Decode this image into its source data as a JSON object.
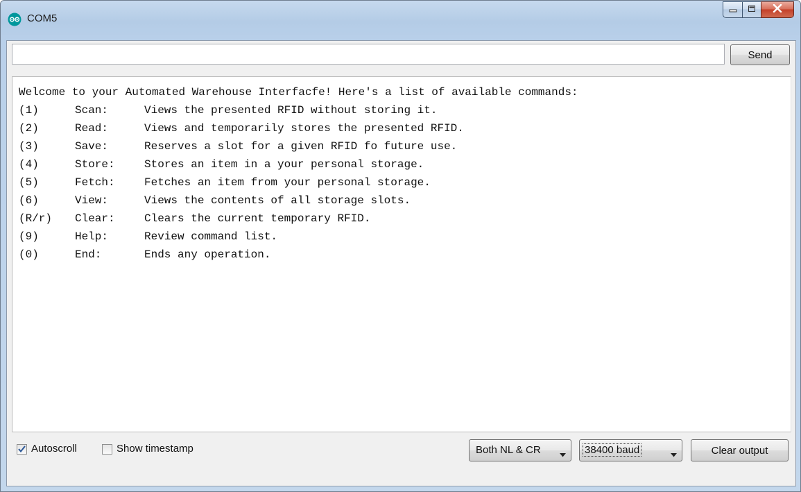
{
  "window": {
    "title": "COM5"
  },
  "icons": {
    "app": "arduino-logo-icon",
    "minimize": "minimize-icon",
    "maximize": "maximize-icon",
    "close": "close-icon",
    "checkmark": "checkmark-icon",
    "dropdown": "chevron-down-icon"
  },
  "input": {
    "value": "",
    "send_label": "Send"
  },
  "output": {
    "header": "Welcome to your Automated Warehouse Interfacfe! Here's a list of available commands:",
    "commands": [
      {
        "key": "(1)",
        "name": "Scan:",
        "desc": "Views the presented RFID without storing it."
      },
      {
        "key": "(2)",
        "name": "Read:",
        "desc": "Views and temporarily stores the presented RFID."
      },
      {
        "key": "(3)",
        "name": "Save:",
        "desc": "Reserves a slot for a given RFID fo future use."
      },
      {
        "key": "(4)",
        "name": "Store:",
        "desc": "Stores an item in a your personal storage."
      },
      {
        "key": "(5)",
        "name": "Fetch:",
        "desc": "Fetches an item from your personal storage."
      },
      {
        "key": "(6)",
        "name": "View:",
        "desc": "Views the contents of all storage slots."
      },
      {
        "key": "(R/r)",
        "name": "Clear:",
        "desc": "Clears the current temporary RFID."
      },
      {
        "key": "(9)",
        "name": "Help:",
        "desc": "Review command list."
      },
      {
        "key": "(0)",
        "name": "End:",
        "desc": "Ends any operation."
      }
    ]
  },
  "bottom": {
    "autoscroll": {
      "label": "Autoscroll",
      "checked": true
    },
    "timestamp": {
      "label": "Show timestamp",
      "checked": false
    },
    "line_ending": "Both NL & CR",
    "baud": "38400 baud",
    "clear_label": "Clear output"
  },
  "colors": {
    "close_button": "#c4412a",
    "title_bar": "#b9d0ea",
    "arduino_teal": "#00979c"
  }
}
